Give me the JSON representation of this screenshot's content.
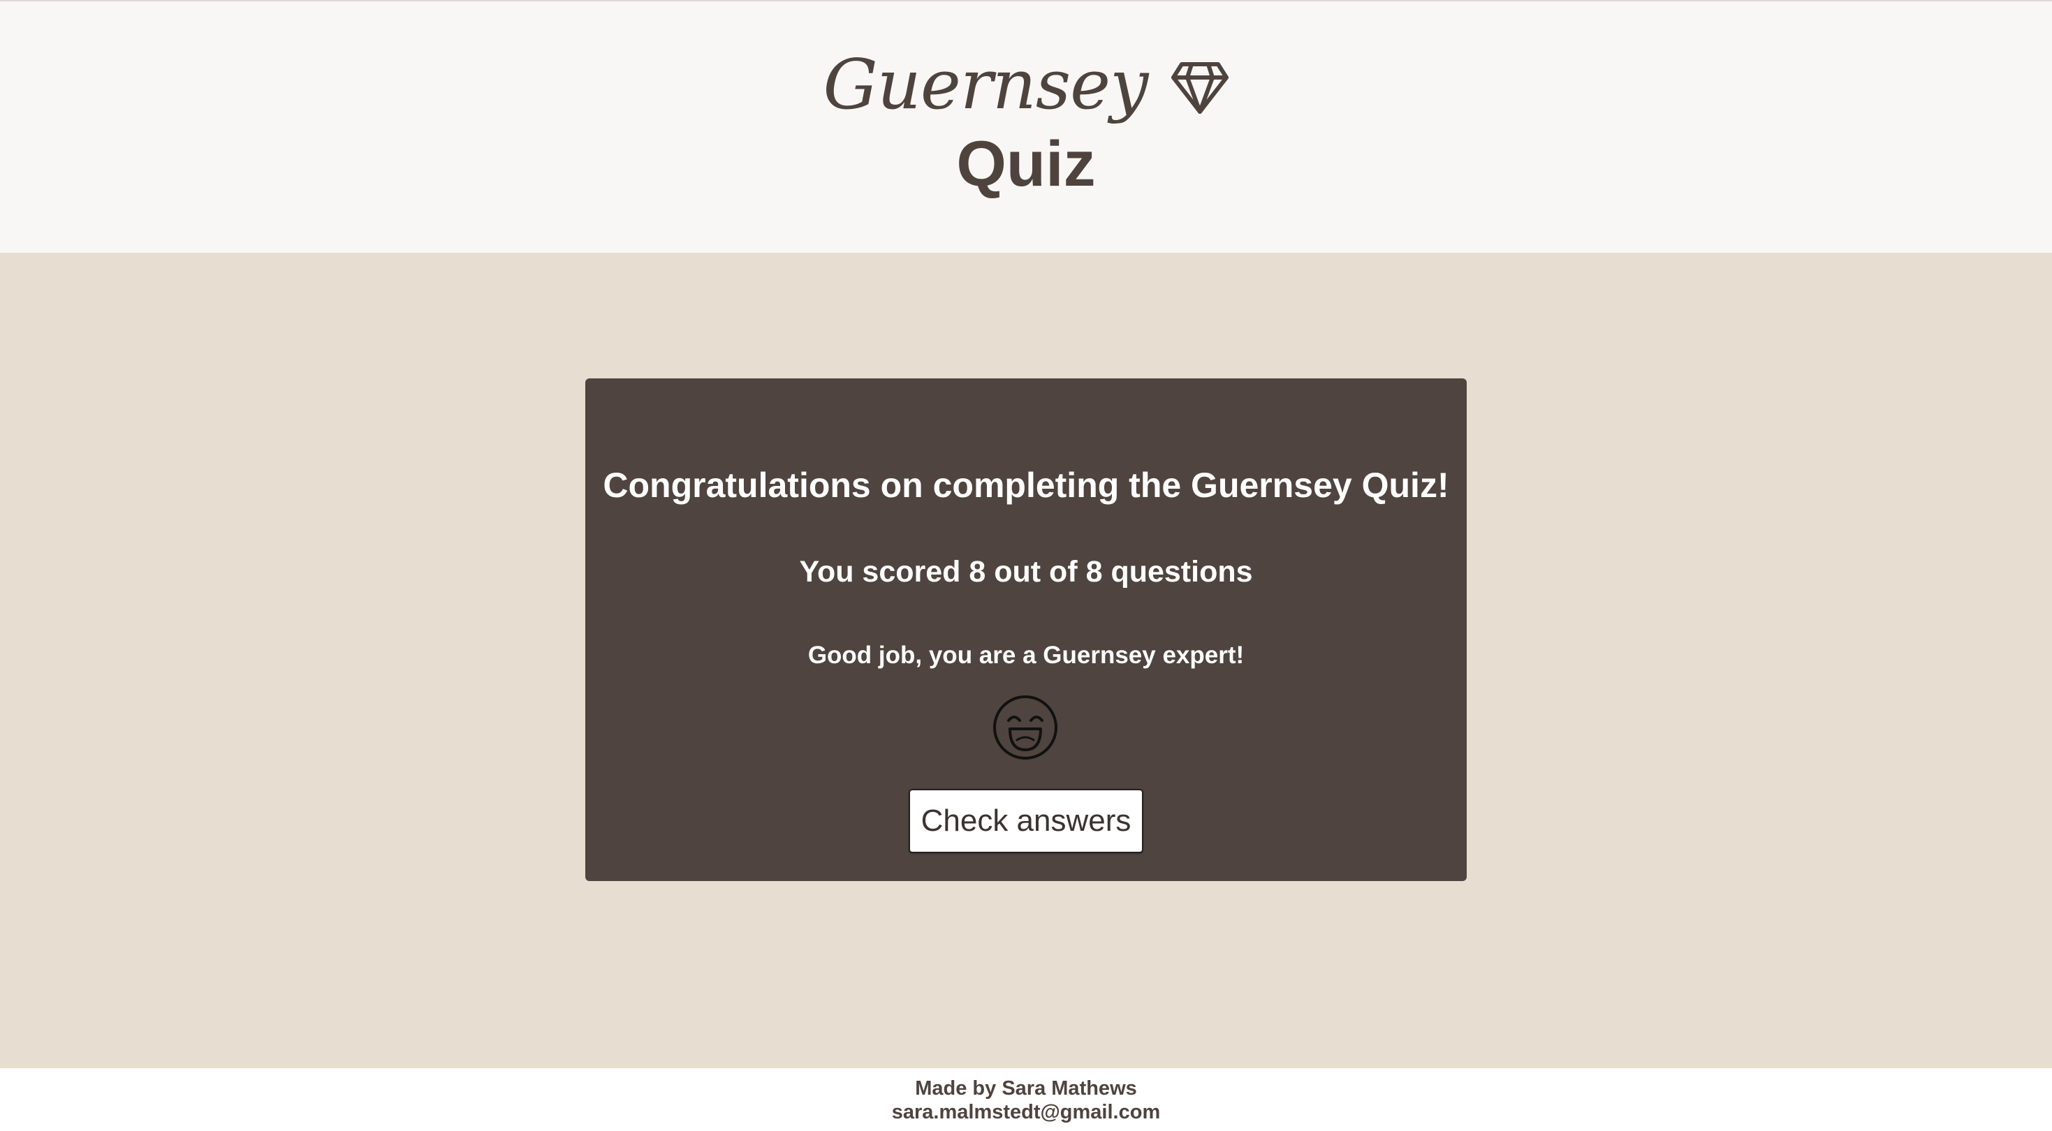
{
  "header": {
    "brand_name": "Guernsey",
    "title": "Quiz",
    "icon": "diamond-icon"
  },
  "result": {
    "headline": "Congratulations on completing the Guernsey Quiz!",
    "score_text": "You scored 8 out of 8 questions",
    "feedback": "Good job, you are a Guernsey expert!",
    "emoji_icon": "grinning-face-icon",
    "check_button_label": "Check answers"
  },
  "footer": {
    "author": "Made by Sara Mathews",
    "email": "sara.malmstedt@gmail.com"
  },
  "colors": {
    "header_bg": "#f8f7f5",
    "main_bg": "#e8ddd1",
    "card_bg": "#4f443f",
    "text_dark": "#4f433e",
    "text_light": "#ffffff"
  }
}
